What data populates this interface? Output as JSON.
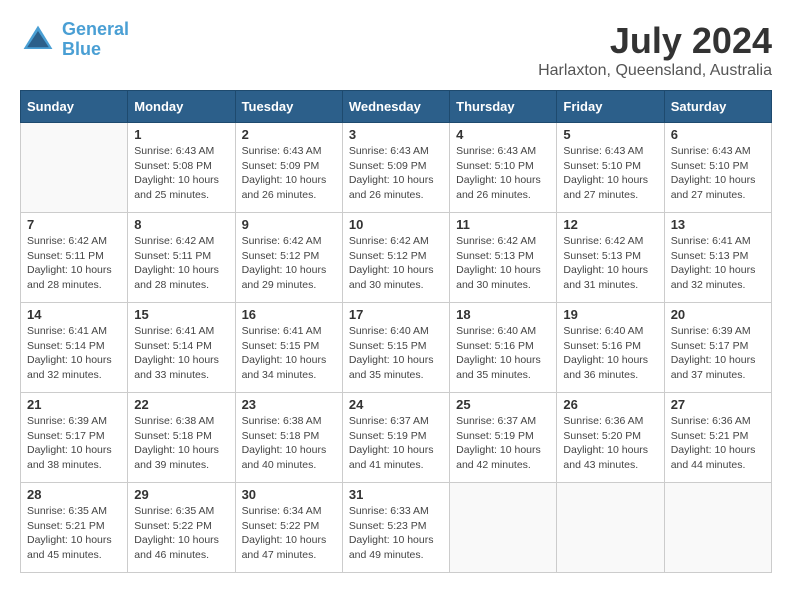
{
  "logo": {
    "name_part1": "General",
    "name_part2": "Blue"
  },
  "header": {
    "month_year": "July 2024",
    "location": "Harlaxton, Queensland, Australia"
  },
  "days_of_week": [
    "Sunday",
    "Monday",
    "Tuesday",
    "Wednesday",
    "Thursday",
    "Friday",
    "Saturday"
  ],
  "weeks": [
    {
      "days": [
        {
          "num": "",
          "info": ""
        },
        {
          "num": "1",
          "info": "Sunrise: 6:43 AM\nSunset: 5:08 PM\nDaylight: 10 hours\nand 25 minutes."
        },
        {
          "num": "2",
          "info": "Sunrise: 6:43 AM\nSunset: 5:09 PM\nDaylight: 10 hours\nand 26 minutes."
        },
        {
          "num": "3",
          "info": "Sunrise: 6:43 AM\nSunset: 5:09 PM\nDaylight: 10 hours\nand 26 minutes."
        },
        {
          "num": "4",
          "info": "Sunrise: 6:43 AM\nSunset: 5:10 PM\nDaylight: 10 hours\nand 26 minutes."
        },
        {
          "num": "5",
          "info": "Sunrise: 6:43 AM\nSunset: 5:10 PM\nDaylight: 10 hours\nand 27 minutes."
        },
        {
          "num": "6",
          "info": "Sunrise: 6:43 AM\nSunset: 5:10 PM\nDaylight: 10 hours\nand 27 minutes."
        }
      ]
    },
    {
      "days": [
        {
          "num": "7",
          "info": "Sunrise: 6:42 AM\nSunset: 5:11 PM\nDaylight: 10 hours\nand 28 minutes."
        },
        {
          "num": "8",
          "info": "Sunrise: 6:42 AM\nSunset: 5:11 PM\nDaylight: 10 hours\nand 28 minutes."
        },
        {
          "num": "9",
          "info": "Sunrise: 6:42 AM\nSunset: 5:12 PM\nDaylight: 10 hours\nand 29 minutes."
        },
        {
          "num": "10",
          "info": "Sunrise: 6:42 AM\nSunset: 5:12 PM\nDaylight: 10 hours\nand 30 minutes."
        },
        {
          "num": "11",
          "info": "Sunrise: 6:42 AM\nSunset: 5:13 PM\nDaylight: 10 hours\nand 30 minutes."
        },
        {
          "num": "12",
          "info": "Sunrise: 6:42 AM\nSunset: 5:13 PM\nDaylight: 10 hours\nand 31 minutes."
        },
        {
          "num": "13",
          "info": "Sunrise: 6:41 AM\nSunset: 5:13 PM\nDaylight: 10 hours\nand 32 minutes."
        }
      ]
    },
    {
      "days": [
        {
          "num": "14",
          "info": "Sunrise: 6:41 AM\nSunset: 5:14 PM\nDaylight: 10 hours\nand 32 minutes."
        },
        {
          "num": "15",
          "info": "Sunrise: 6:41 AM\nSunset: 5:14 PM\nDaylight: 10 hours\nand 33 minutes."
        },
        {
          "num": "16",
          "info": "Sunrise: 6:41 AM\nSunset: 5:15 PM\nDaylight: 10 hours\nand 34 minutes."
        },
        {
          "num": "17",
          "info": "Sunrise: 6:40 AM\nSunset: 5:15 PM\nDaylight: 10 hours\nand 35 minutes."
        },
        {
          "num": "18",
          "info": "Sunrise: 6:40 AM\nSunset: 5:16 PM\nDaylight: 10 hours\nand 35 minutes."
        },
        {
          "num": "19",
          "info": "Sunrise: 6:40 AM\nSunset: 5:16 PM\nDaylight: 10 hours\nand 36 minutes."
        },
        {
          "num": "20",
          "info": "Sunrise: 6:39 AM\nSunset: 5:17 PM\nDaylight: 10 hours\nand 37 minutes."
        }
      ]
    },
    {
      "days": [
        {
          "num": "21",
          "info": "Sunrise: 6:39 AM\nSunset: 5:17 PM\nDaylight: 10 hours\nand 38 minutes."
        },
        {
          "num": "22",
          "info": "Sunrise: 6:38 AM\nSunset: 5:18 PM\nDaylight: 10 hours\nand 39 minutes."
        },
        {
          "num": "23",
          "info": "Sunrise: 6:38 AM\nSunset: 5:18 PM\nDaylight: 10 hours\nand 40 minutes."
        },
        {
          "num": "24",
          "info": "Sunrise: 6:37 AM\nSunset: 5:19 PM\nDaylight: 10 hours\nand 41 minutes."
        },
        {
          "num": "25",
          "info": "Sunrise: 6:37 AM\nSunset: 5:19 PM\nDaylight: 10 hours\nand 42 minutes."
        },
        {
          "num": "26",
          "info": "Sunrise: 6:36 AM\nSunset: 5:20 PM\nDaylight: 10 hours\nand 43 minutes."
        },
        {
          "num": "27",
          "info": "Sunrise: 6:36 AM\nSunset: 5:21 PM\nDaylight: 10 hours\nand 44 minutes."
        }
      ]
    },
    {
      "days": [
        {
          "num": "28",
          "info": "Sunrise: 6:35 AM\nSunset: 5:21 PM\nDaylight: 10 hours\nand 45 minutes."
        },
        {
          "num": "29",
          "info": "Sunrise: 6:35 AM\nSunset: 5:22 PM\nDaylight: 10 hours\nand 46 minutes."
        },
        {
          "num": "30",
          "info": "Sunrise: 6:34 AM\nSunset: 5:22 PM\nDaylight: 10 hours\nand 47 minutes."
        },
        {
          "num": "31",
          "info": "Sunrise: 6:33 AM\nSunset: 5:23 PM\nDaylight: 10 hours\nand 49 minutes."
        },
        {
          "num": "",
          "info": ""
        },
        {
          "num": "",
          "info": ""
        },
        {
          "num": "",
          "info": ""
        }
      ]
    }
  ]
}
